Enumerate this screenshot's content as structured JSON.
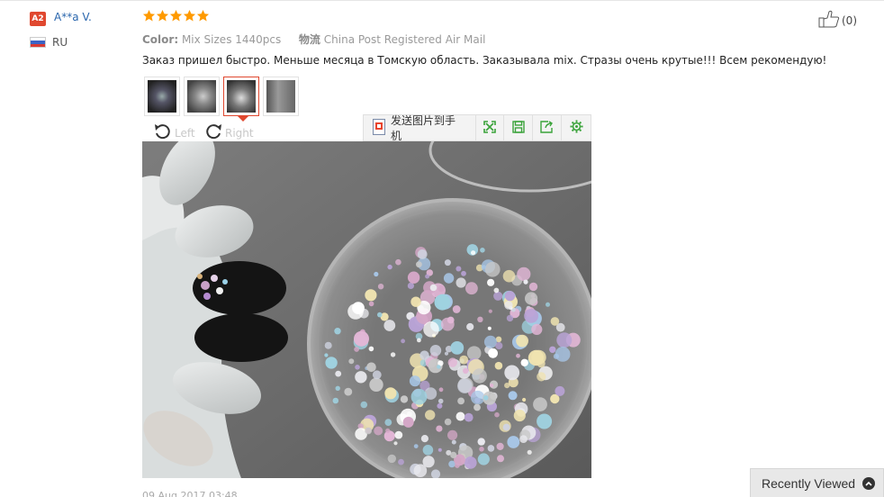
{
  "user": {
    "level_badge": "A2",
    "name": "A**a V.",
    "country": "RU",
    "flag_icon": "russia-flag-icon"
  },
  "review": {
    "rating": 5,
    "rating_max": 5,
    "star_color": "#ff9a00",
    "color_label": "Color:",
    "color_value": "Mix Sizes 1440pcs",
    "logistics_label": "物流",
    "logistics_value": "China Post Registered Air Mail",
    "text": "Заказ пришел быстро. Меньше месяца в Томскую область. Заказывала mix. Стразы очень крутые!!! Всем рекомендую!",
    "date": "09 Aug 2017 03:48"
  },
  "helpful": {
    "icon": "thumbs-up-icon",
    "count": "(0)"
  },
  "thumbnails": {
    "count": 4,
    "active_index": 2
  },
  "viewer": {
    "rotate_left_label": "Left",
    "rotate_right_label": "Right",
    "send_label": "发送图片到手机",
    "tool_icons": [
      "fullscreen-icon",
      "save-icon",
      "share-icon",
      "settings-icon"
    ],
    "accent_color": "#3aa33a"
  },
  "recently_viewed": {
    "label": "Recently Viewed",
    "icon": "chevron-up-icon"
  }
}
